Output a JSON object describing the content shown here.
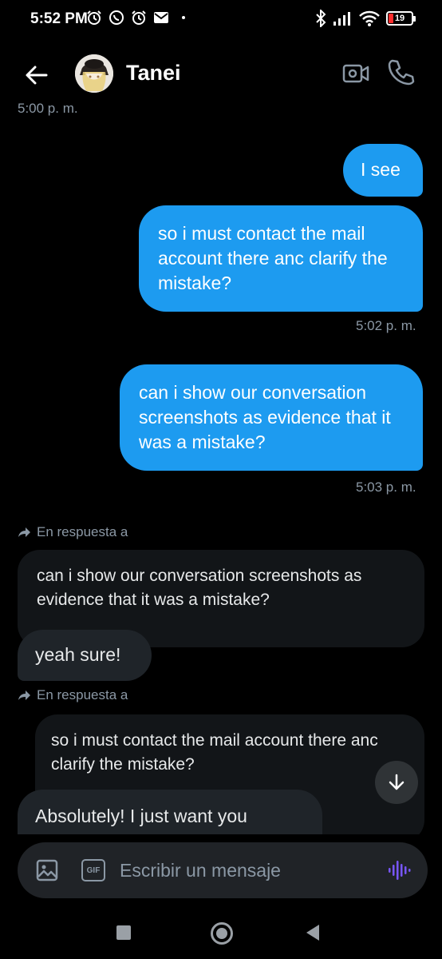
{
  "status_bar": {
    "time": "5:52 PM",
    "battery": "19",
    "icons": [
      "alarm-icon",
      "whatsapp-icon",
      "alarm-icon",
      "mail-icon",
      "bluetooth-icon",
      "signal-icon",
      "wifi-icon",
      "battery-icon"
    ]
  },
  "header": {
    "name": "Tanei"
  },
  "chat": {
    "top_timestamp": "5:00 p. m.",
    "messages": [
      {
        "text": "I see"
      },
      {
        "text": "so i must contact the mail account there anc clarify the mistake?"
      },
      {
        "time": "5:02 p. m."
      },
      {
        "text": "can i show our conversation screenshots as evidence that it was a mistake?"
      },
      {
        "time": "5:03 p. m."
      }
    ],
    "reply_label": "En respuesta a",
    "quote1": "can i show our conversation screenshots as evidence that it was a mistake?",
    "reply1": "yeah sure!",
    "quote2": "so i must contact the mail account there anc clarify the mistake?",
    "reply2": "Absolutely! I just want you"
  },
  "composer": {
    "gif_label": "GIF",
    "placeholder": "Escribir un mensaje"
  },
  "colors": {
    "outgoing_bubble": "#1d9bf0",
    "incoming_bubble": "#1f2429",
    "background": "#000000",
    "voice_accent": "#7856ff"
  }
}
